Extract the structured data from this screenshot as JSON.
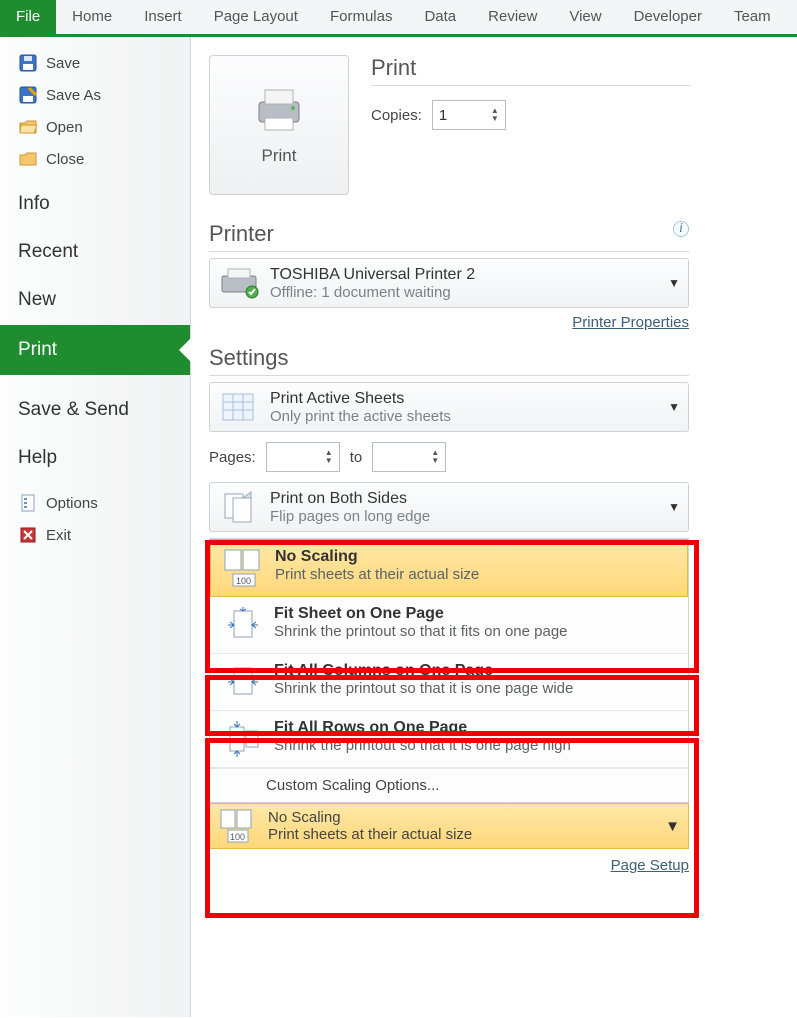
{
  "ribbon": {
    "tabs": [
      "File",
      "Home",
      "Insert",
      "Page Layout",
      "Formulas",
      "Data",
      "Review",
      "View",
      "Developer",
      "Team"
    ],
    "active": "File"
  },
  "sidebar": {
    "save": "Save",
    "save_as": "Save As",
    "open": "Open",
    "close": "Close",
    "info": "Info",
    "recent": "Recent",
    "new": "New",
    "print": "Print",
    "save_send": "Save & Send",
    "help": "Help",
    "options": "Options",
    "exit": "Exit"
  },
  "print_panel": {
    "print_button": "Print",
    "title": "Print",
    "copies_label": "Copies:",
    "copies_value": "1"
  },
  "printer": {
    "section": "Printer",
    "name": "TOSHIBA Universal Printer 2",
    "status": "Offline: 1 document waiting",
    "properties_link": "Printer Properties"
  },
  "settings": {
    "section": "Settings",
    "what": {
      "title": "Print Active Sheets",
      "sub": "Only print the active sheets"
    },
    "pages_label": "Pages:",
    "pages_to": "to",
    "sides": {
      "title": "Print on Both Sides",
      "sub": "Flip pages on long edge"
    },
    "scaling_options": [
      {
        "title": "No Scaling",
        "sub": "Print sheets at their actual size"
      },
      {
        "title": "Fit Sheet on One Page",
        "sub": "Shrink the printout so that it fits on one page"
      },
      {
        "title": "Fit All Columns on One Page",
        "sub": "Shrink the printout so that it is one page wide"
      },
      {
        "title": "Fit All Rows on One Page",
        "sub": "Shrink the printout so that it is one page high"
      }
    ],
    "custom_scaling": "Custom Scaling Options...",
    "current_scaling": {
      "title": "No Scaling",
      "sub": "Print sheets at their actual size"
    },
    "page_setup_link": "Page Setup"
  }
}
